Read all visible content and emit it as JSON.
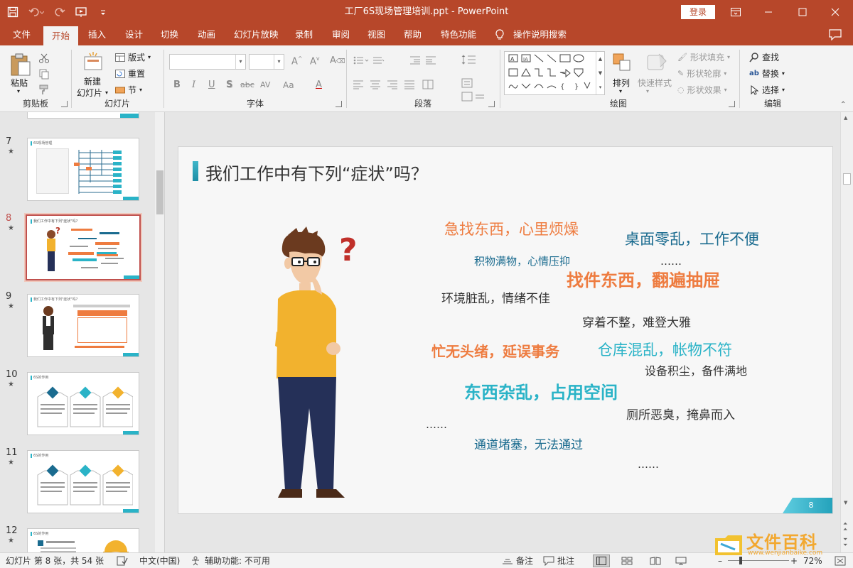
{
  "window": {
    "title": "工厂6S现场管理培训.ppt  -  PowerPoint",
    "login": "登录"
  },
  "tabs": [
    "文件",
    "开始",
    "插入",
    "设计",
    "切换",
    "动画",
    "幻灯片放映",
    "录制",
    "审阅",
    "视图",
    "帮助",
    "特色功能",
    "操作说明搜索"
  ],
  "ribbon": {
    "clipboard": {
      "paste": "粘贴",
      "label": "剪贴板"
    },
    "slides": {
      "new_slide_1": "新建",
      "new_slide_2": "幻灯片",
      "layout": "版式",
      "reset": "重置",
      "section": "节",
      "label": "幻灯片"
    },
    "font": {
      "bold": "B",
      "italic": "I",
      "underline": "U",
      "shadow": "S",
      "strike": "abc",
      "spacing": "AV",
      "case": "Aa",
      "color": "A",
      "label": "字体"
    },
    "paragraph": {
      "label": "段落"
    },
    "drawing": {
      "arrange": "排列",
      "quick_styles": "快速样式",
      "shape_fill": "形状填充",
      "shape_outline": "形状轮廓",
      "shape_effects": "形状效果",
      "label": "绘图"
    },
    "editing": {
      "find": "查找",
      "replace": "替换",
      "select": "选择",
      "label": "编辑"
    }
  },
  "thumbnails": [
    {
      "num": "7",
      "star": "★",
      "title": "6S现场管理"
    },
    {
      "num": "8",
      "star": "★",
      "title": "我们工作中有下列\"症状\"吗?"
    },
    {
      "num": "9",
      "star": "★",
      "title": "我们工作中有下列\"症状\"吗?"
    },
    {
      "num": "10",
      "star": "★",
      "title": "6S的作用"
    },
    {
      "num": "11",
      "star": "★",
      "title": "6S的作用"
    },
    {
      "num": "12",
      "star": "★",
      "title": "6S的作用"
    }
  ],
  "slide": {
    "title": "我们工作中有下列“症状”吗？",
    "page": "8",
    "phrases": [
      {
        "text": "急找东西，心里烦燥"
      },
      {
        "text": "桌面零乱，工作不便"
      },
      {
        "text": "积物满物，心情压抑"
      },
      {
        "text": "……"
      },
      {
        "text": "找件东西，翻遍抽屉"
      },
      {
        "text": "环境脏乱，情绪不佳"
      },
      {
        "text": "穿着不整，难登大雅"
      },
      {
        "text": "忙无头绪，延误事务"
      },
      {
        "text": "仓库混乱，帐物不符"
      },
      {
        "text": "设备积尘，备件满地"
      },
      {
        "text": "东西杂乱，占用空间"
      },
      {
        "text": "厕所恶臭，掩鼻而入"
      },
      {
        "text": "……"
      },
      {
        "text": "通道堵塞，无法通过"
      },
      {
        "text": "……"
      }
    ]
  },
  "status": {
    "slide_info": "幻灯片 第 8 张，共 54 张",
    "language": "中文(中国)",
    "accessibility": "辅助功能: 不可用",
    "notes": "备注",
    "comments": "批注",
    "zoom": "72%"
  },
  "watermark": {
    "text": "文件百科",
    "url": "www.wenjianbaike.com"
  },
  "colors": {
    "accent": "#b7472a",
    "orange": "#ee7c40",
    "blue": "#1a6b8f",
    "teal": "#2ab3c7"
  }
}
